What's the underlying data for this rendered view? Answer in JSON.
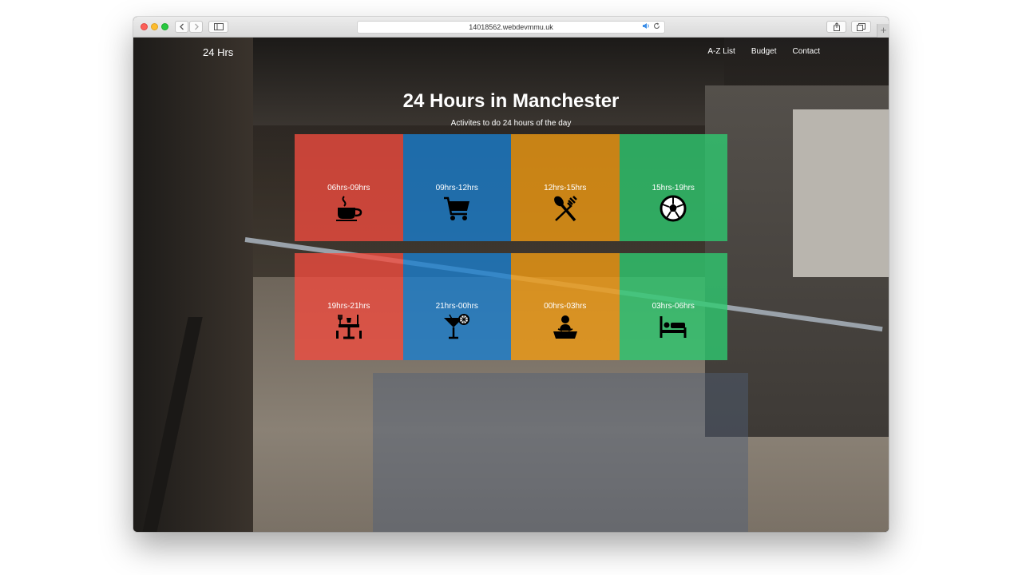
{
  "browser": {
    "address": "14018562.webdevmmu.uk"
  },
  "site": {
    "logo": "24 Hrs",
    "nav": [
      "A-Z List",
      "Budget",
      "Contact"
    ],
    "title": "24 Hours in Manchester",
    "subtitle": "Activites to do 24 hours of the day"
  },
  "colors": {
    "red": "#f24b3f",
    "blue": "#1a7fd0",
    "orange": "#f39c12",
    "green": "#2ecc71"
  },
  "tiles": [
    {
      "label": "06hrs-09hrs",
      "icon": "coffee-cup-icon",
      "color": "red"
    },
    {
      "label": "09hrs-12hrs",
      "icon": "shopping-cart-icon",
      "color": "blue"
    },
    {
      "label": "12hrs-15hrs",
      "icon": "fork-spoon-icon",
      "color": "orange"
    },
    {
      "label": "15hrs-19hrs",
      "icon": "football-icon",
      "color": "green"
    },
    {
      "label": "19hrs-21hrs",
      "icon": "dinner-table-icon",
      "color": "red"
    },
    {
      "label": "21hrs-00hrs",
      "icon": "cocktail-icon",
      "color": "blue"
    },
    {
      "label": "00hrs-03hrs",
      "icon": "dj-icon",
      "color": "orange"
    },
    {
      "label": "03hrs-06hrs",
      "icon": "bed-icon",
      "color": "green"
    }
  ]
}
